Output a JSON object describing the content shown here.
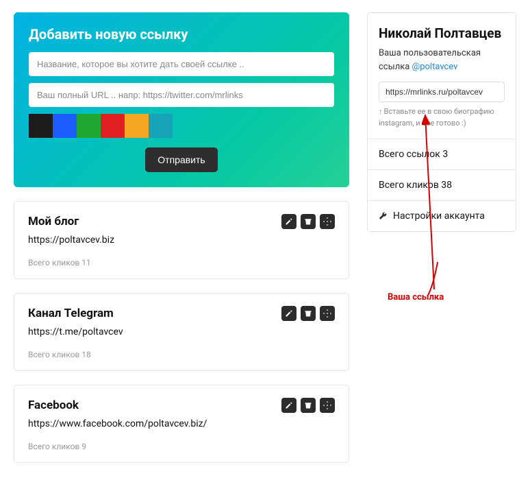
{
  "form": {
    "title": "Добавить новую ссылку",
    "name_placeholder": "Название, которое вы хотите дать своей ссылке ..",
    "url_placeholder": "Ваш полный URL .. напр: https://twitter.com/mrlinks",
    "submit_label": "Отправить",
    "colors": [
      "#1c1c1c",
      "#1a5cff",
      "#1fa82f",
      "#e02020",
      "#f5a623",
      "#17a2b8"
    ]
  },
  "links": [
    {
      "title": "Мой блог",
      "url": "https://poltavcev.biz",
      "clicks_label": "Всего кликов 11"
    },
    {
      "title": "Канал Telegram",
      "url": "https://t.me/poltavcev",
      "clicks_label": "Всего кликов 18"
    },
    {
      "title": "Facebook",
      "url": "https://www.facebook.com/poltavcev.biz/",
      "clicks_label": "Всего кликов 9"
    }
  ],
  "profile": {
    "name": "Николай Полтавцев",
    "sub_pre": "Ваша пользовательская ссылка ",
    "handle": "@poltavcev",
    "link_value": "https://mrlinks.ru/poltavcev",
    "hint": "Вставьте ее в свою биографию instagram, и все готово :)",
    "stat_links": "Всего ссылок 3",
    "stat_clicks": "Всего кликов 38",
    "settings_label": "Настройки аккаунта"
  },
  "annotation": {
    "label": "Ваша ссылка"
  }
}
